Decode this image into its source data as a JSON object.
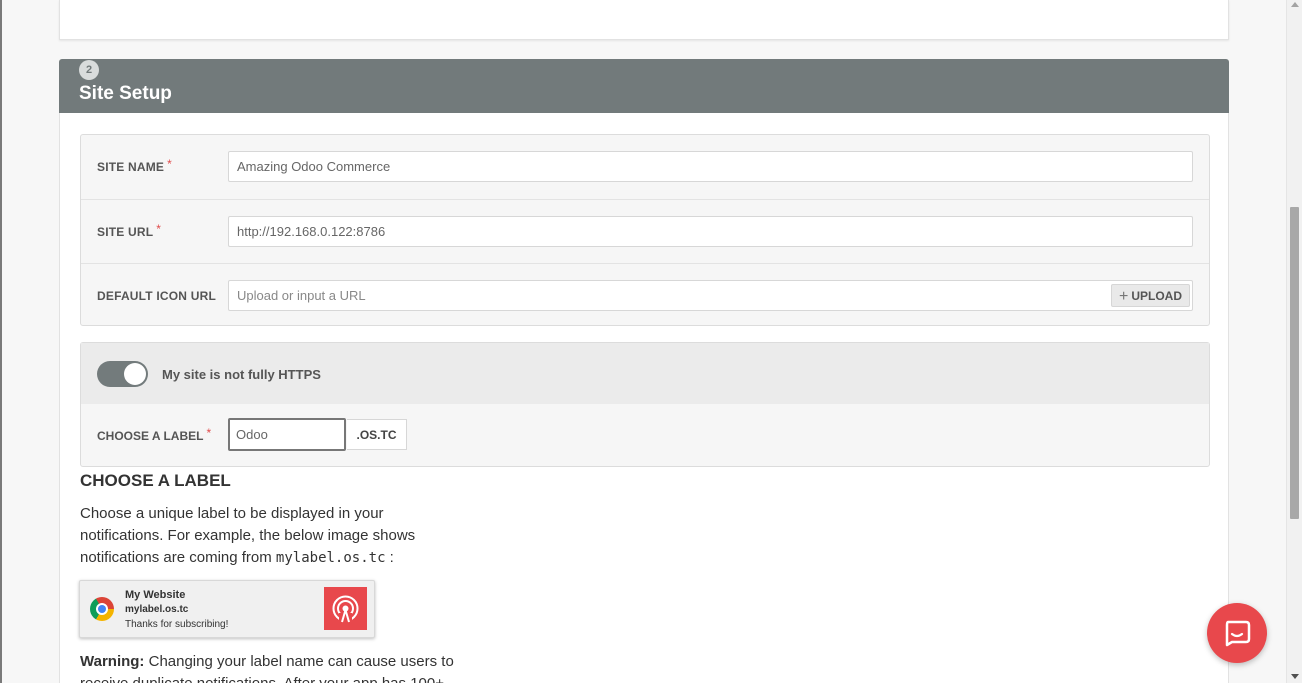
{
  "section": {
    "step_number": "2",
    "title": "Site Setup"
  },
  "form": {
    "site_name": {
      "label": "SITE NAME",
      "required_mark": "*",
      "value": "Amazing Odoo Commerce"
    },
    "site_url": {
      "label": "SITE URL",
      "required_mark": "*",
      "value": "http://192.168.0.122:8786"
    },
    "default_icon_url": {
      "label": "DEFAULT ICON URL",
      "placeholder": "Upload or input a URL",
      "upload_label": "UPLOAD",
      "upload_icon": "plus-icon"
    }
  },
  "https": {
    "toggle_label": "My site is not fully HTTPS",
    "toggle_state": "on"
  },
  "label_field": {
    "label": "CHOOSE A LABEL",
    "required_mark": "*",
    "value": "Odoo",
    "suffix": ".OS.TC"
  },
  "help": {
    "heading": "CHOOSE A LABEL",
    "text_before": "Choose a unique label to be displayed in your notifications. For example, the below image shows notifications are coming from ",
    "code": "mylabel.os.tc",
    "text_after": " :",
    "notification": {
      "title": "My Website",
      "domain": "mylabel.os.tc",
      "message": "Thanks for subscribing!",
      "browser_icon": "chrome-icon",
      "logo_icon": "broadcast-icon"
    },
    "warning_label": "Warning:",
    "warning_text": " Changing your label name can cause users to receive duplicate notifications. After your app has 100+"
  },
  "chat": {
    "icon": "chat-icon"
  },
  "colors": {
    "header_bg": "#727a7b",
    "accent_red": "#e8484c",
    "required_red": "#e04b4b"
  }
}
